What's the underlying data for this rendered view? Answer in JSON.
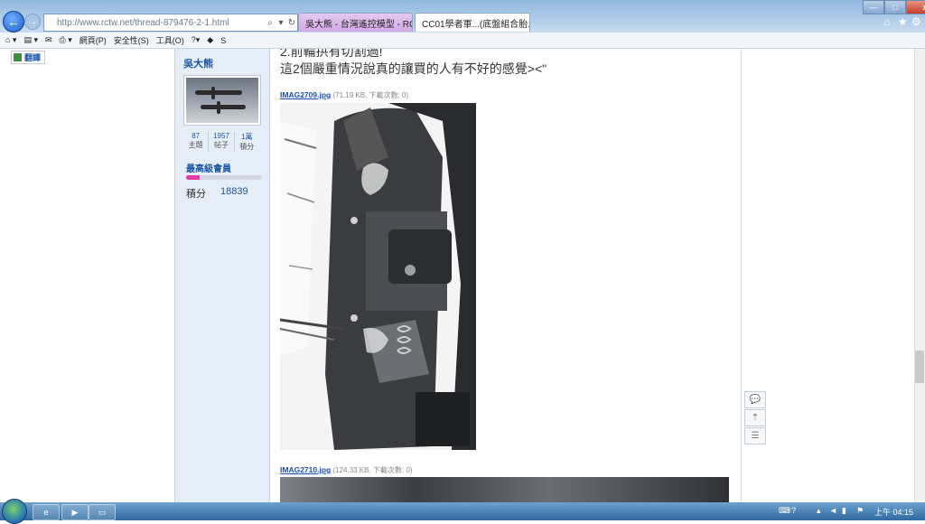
{
  "browser": {
    "url": "http://www.rctw.net/thread-879476-2-1.html",
    "tabs": [
      {
        "label": "吳大熊 - 台灣遙控模型 - RC T..."
      },
      {
        "label": "CC01學者軍...(底盤組合胎..."
      }
    ],
    "window_buttons": {
      "min": "—",
      "max": "□",
      "close": "x"
    },
    "right_icons": [
      "home-icon",
      "star-icon",
      "gear-icon"
    ]
  },
  "command_bar": {
    "page": "網頁(P)",
    "safety": "安全性(S)",
    "tools": "工具(O)"
  },
  "translate_label": "翻譯",
  "user": {
    "name": "吳大熊",
    "stats": [
      {
        "value": "87",
        "label": "主題"
      },
      {
        "value": "1957",
        "label": "帖子"
      },
      {
        "value": "1萬",
        "label": "積分"
      }
    ],
    "rank": "最高級會員",
    "rank_progress": 0.18,
    "points_label": "積分",
    "points_value": "18839"
  },
  "post": {
    "line1": "2.前輪拱有切割過!",
    "line2": "這2個嚴重情況說真的讓買的人有不好的感覺><\"",
    "attachments": [
      {
        "name": "IMAG2709.jpg",
        "meta": "(71.19 KB, 下載次數: 0)"
      },
      {
        "name": "IMAG2710.jpg",
        "meta": "(124.33 KB, 下載次數: 0)"
      }
    ]
  },
  "taskbar": {
    "clock": "上午 04:15"
  },
  "colors": {
    "link": "#1b4fb8",
    "sidebar_bg": "#e5edf7",
    "rank_bar": "#e23aa4",
    "taskbar": "#2f6aa0"
  }
}
